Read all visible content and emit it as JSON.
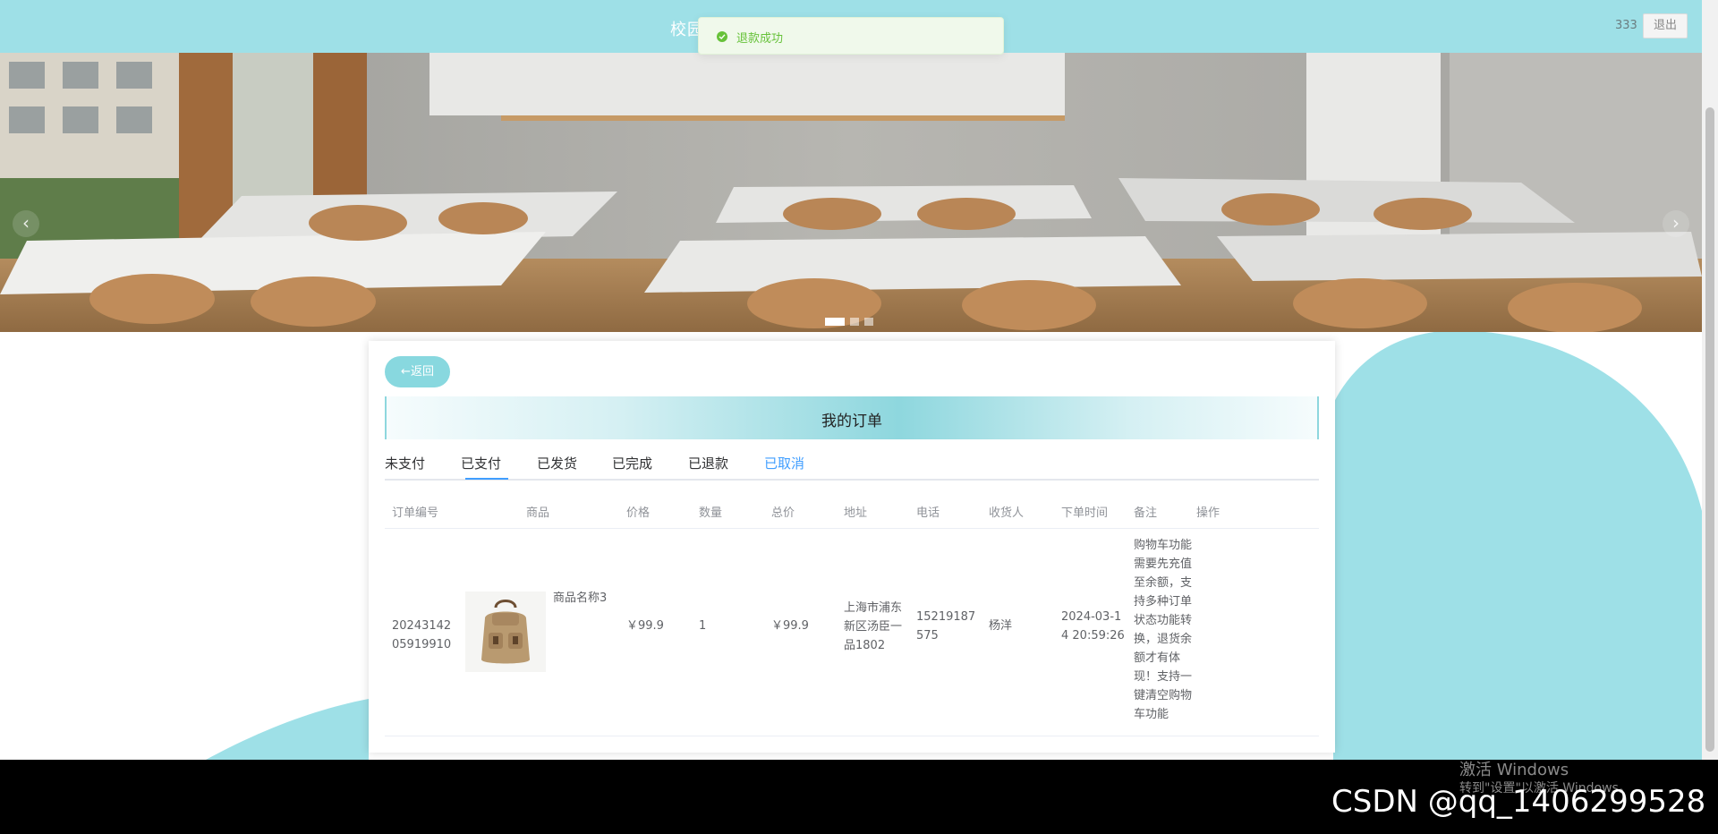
{
  "header": {
    "site_title": "校园",
    "username": "333",
    "logout_label": "退出"
  },
  "toast": {
    "message": "退款成功",
    "color": "#67c23a"
  },
  "carousel": {
    "prev_icon": "‹",
    "next_icon": "›",
    "slide_count": 3,
    "active_index": 0
  },
  "order_page": {
    "back_label": "←返回",
    "title": "我的订单",
    "tabs": [
      {
        "label": "未支付",
        "active": false
      },
      {
        "label": "已支付",
        "active": true
      },
      {
        "label": "已发货",
        "active": false
      },
      {
        "label": "已完成",
        "active": false
      },
      {
        "label": "已退款",
        "active": false
      },
      {
        "label": "已取消",
        "active": false
      }
    ],
    "columns": [
      "订单编号",
      "商品",
      "价格",
      "数量",
      "总价",
      "地址",
      "电话",
      "收货人",
      "下单时间",
      "备注",
      "操作"
    ],
    "rows": [
      {
        "order_no_1": "20243142",
        "order_no_2": "05919910",
        "product_name": "商品名称3",
        "price": "￥99.9",
        "quantity": "1",
        "total": "￥99.9",
        "address_1": "上海市浦东",
        "address_2": "新区汤臣一",
        "address_3": "品1802",
        "phone_1": "15219187",
        "phone_2": "575",
        "receiver": "杨洋",
        "time_1": "2024-03-1",
        "time_2": "4 20:59:26",
        "note_lines": [
          "购物车功能",
          "需要先充值",
          "至余额，支",
          "持多种订单",
          "状态功能转",
          "换，退货余",
          "额才有体",
          "现！支持一",
          "键清空购物",
          "车功能"
        ]
      }
    ]
  },
  "system": {
    "activate_title": "激活 Windows",
    "activate_hint": "转到\"设置\"以激活 Windows。",
    "watermark": "CSDN @qq_1406299528"
  },
  "colors": {
    "topbar": "#9ee0e7",
    "accent": "#88d8df",
    "tab_active": "#409eff"
  }
}
